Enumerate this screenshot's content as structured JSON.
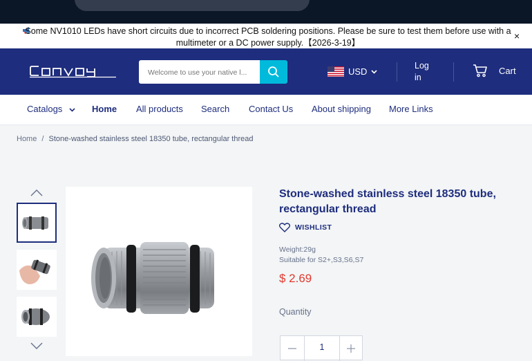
{
  "announcement": {
    "text": "Some NV1010 LEDs have short circuits due to incorrect PCB soldering positions. Please be sure to test them before use with a multimeter or a DC power supply.【2026-3-19】",
    "close_label": "×"
  },
  "header": {
    "logo_text": "Convoy",
    "search_placeholder": "Welcome to use your native l...",
    "currency": "USD",
    "login_label": "Log in",
    "cart_label": "Cart"
  },
  "nav": {
    "items": [
      "Catalogs",
      "Home",
      "All products",
      "Search",
      "Contact Us",
      "About shipping",
      "More Links"
    ]
  },
  "breadcrumb": {
    "home": "Home",
    "separator": "/",
    "current": "Stone-washed stainless steel 18350 tube, rectangular thread"
  },
  "product": {
    "title": "Stone-washed stainless steel 18350 tube, rectangular thread",
    "wishlist_label": "WISHLIST",
    "weight": "Weight:29g",
    "suitable": "Suitable for S2+,S3,S6,S7",
    "price": "$ 2.69",
    "quantity_label": "Quantity",
    "quantity_value": "1"
  },
  "colors": {
    "brand": "#1e2d7d",
    "accent": "#00badb",
    "price": "#e0392e"
  }
}
